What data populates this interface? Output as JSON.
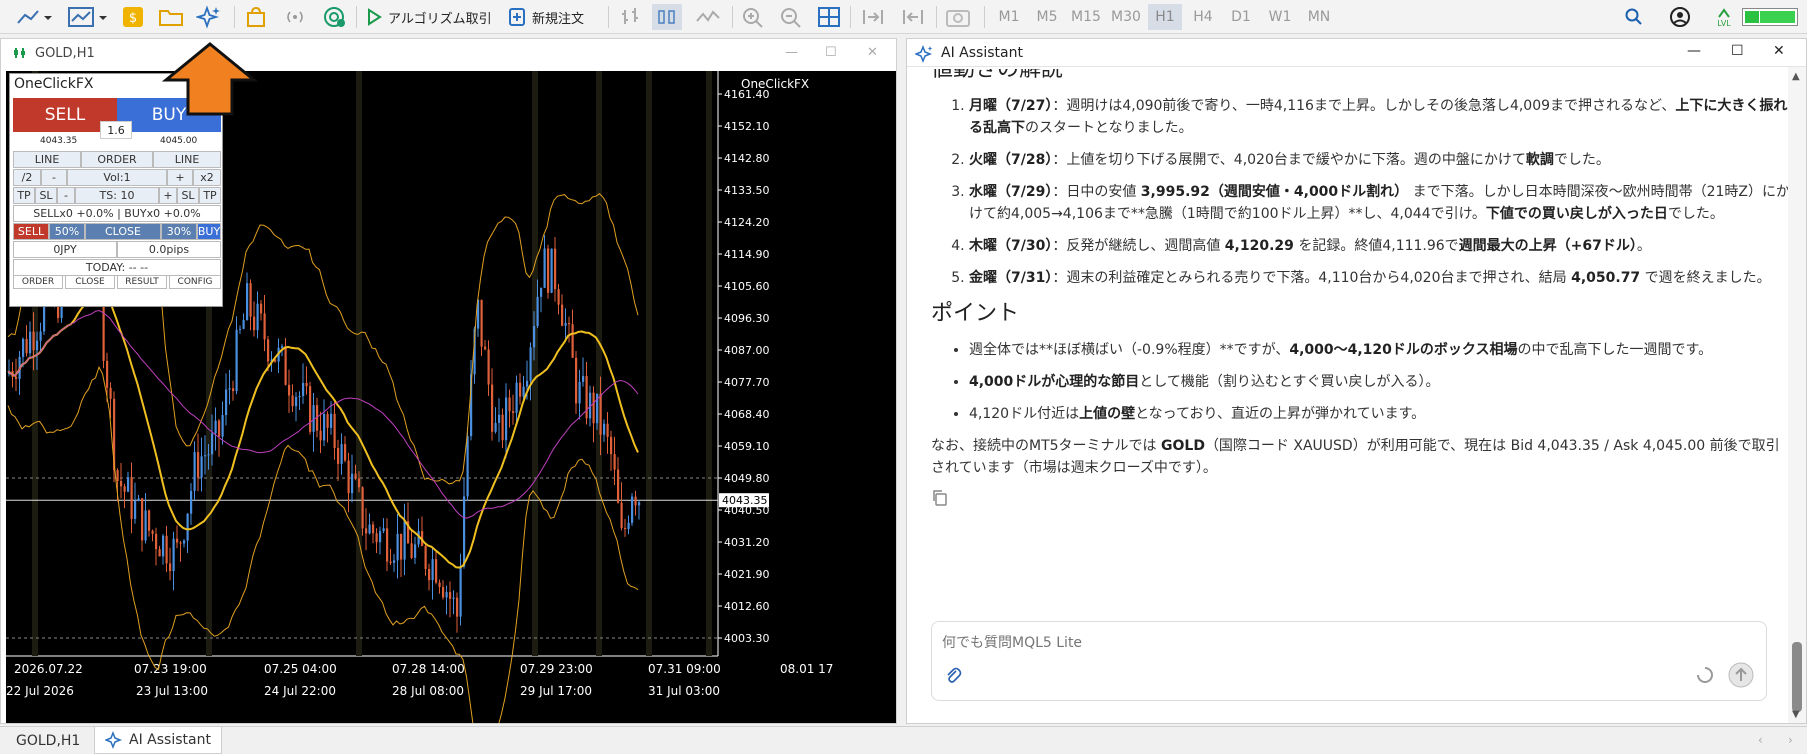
{
  "toolbar": {
    "algo_trading_label": "アルゴリズム取引",
    "new_order_label": "新規注文",
    "timeframes": [
      "M1",
      "M5",
      "M15",
      "M30",
      "H1",
      "H4",
      "D1",
      "W1",
      "MN"
    ],
    "active_timeframe": "H1",
    "status_label": "LVL"
  },
  "chart_window": {
    "title": "GOLD,H1",
    "symbol_label": "OneClickFX",
    "current_price": "4043.35",
    "price_ticks": [
      "4161.40",
      "4152.10",
      "4142.80",
      "4133.50",
      "4124.20",
      "4114.90",
      "4105.60",
      "4096.30",
      "4087.00",
      "4077.70",
      "4068.40",
      "4059.10",
      "4049.80",
      "4040.50",
      "4031.20",
      "4021.90",
      "4012.60",
      "4003.30"
    ],
    "time_ticks_top": [
      "2026.07.22",
      "07.23 19:00",
      "07.25 04:00",
      "07.28 14:00",
      "07.29 23:00",
      "07.31 09:00",
      "08.01 17"
    ],
    "time_ticks_bottom": [
      "22 Jul 2026",
      "23 Jul 13:00",
      "24 Jul 22:00",
      "28 Jul 08:00",
      "29 Jul 17:00",
      "31 Jul 03:00"
    ]
  },
  "oneclick": {
    "title": "OneClickFX",
    "sell_label": "SELL",
    "buy_label": "BUY",
    "spread": "1.6",
    "bid": "4043.35",
    "ask": "4045.00",
    "row1": [
      "LINE",
      "ORDER",
      "LINE"
    ],
    "row2": [
      "/2",
      "-",
      "Vol:1",
      "+",
      "x2"
    ],
    "row3": [
      "TP",
      "SL",
      "-",
      "TS: 10",
      "+",
      "SL",
      "TP"
    ],
    "row4": "SELLx0 +0.0% | BUYx0 +0.0%",
    "row5": [
      "SELL",
      "50%",
      "CLOSE",
      "30%",
      "BUY"
    ],
    "row6": [
      "0JPY",
      "0.0pips"
    ],
    "today": "TODAY: -- --",
    "footer": [
      "ORDER",
      "CLOSE",
      "RESULT",
      "CONFIG"
    ]
  },
  "ai_window": {
    "title": "AI Assistant",
    "partial_heading": "値動きの解説",
    "days": [
      {
        "lead": "月曜（7/27）",
        "text1": "：週明けは4,090前後で寄り、一時4,116まで上昇。しかしその後急落し4,009まで押されるなど、",
        "bold": "上下に大きく振れる乱高下",
        "text2": "のスタートとなりました。"
      },
      {
        "lead": "火曜（7/28）",
        "text1": "：上値を切り下げる展開で、4,020台まで緩やかに下落。週の中盤にかけて",
        "bold": "軟調",
        "text2": "でした。"
      },
      {
        "lead": "水曜（7/29）",
        "text1": "：日中の安値 ",
        "bold": "3,995.92（週間安値・4,000ドル割れ）",
        "text2": " まで下落。しかし日本時間深夜〜欧州時間帯（21時Z）にかけて約4,005→4,106まで**急騰（1時間で約100ドル上昇）**し、4,044で引け。",
        "bold2": "下値での買い戻しが入った日",
        "text3": "でした。"
      },
      {
        "lead": "木曜（7/30）",
        "text1": "：反発が継続し、週間高値 ",
        "bold": "4,120.29",
        "text2": " を記録。終値4,111.96で",
        "bold2": "週間最大の上昇（+67ドル）",
        "text3": "。"
      },
      {
        "lead": "金曜（7/31）",
        "text1": "：週末の利益確定とみられる売りで下落。4,110台から4,020台まで押され、結局 ",
        "bold": "4,050.77",
        "text2": " で週を終えました。"
      }
    ],
    "points_heading": "ポイント",
    "points": [
      {
        "text1": "週全体では**ほぼ横ばい（-0.9%程度）**ですが、",
        "bold": "4,000〜4,120ドルのボックス相場",
        "text2": "の中で乱高下した一週間です。"
      },
      {
        "text1": "",
        "bold": "4,000ドルが心理的な節目",
        "text2": "として機能（割り込むとすぐ買い戻しが入る）。"
      },
      {
        "text1": "4,120ドル付近は",
        "bold": "上値の壁",
        "text2": "となっており、直近の上昇が弾かれています。"
      }
    ],
    "footer_text1": "なお、接続中のMT5ターミナルでは ",
    "footer_bold": "GOLD",
    "footer_text2": "（国際コード XAUUSD）が利用可能で、現在は Bid 4,043.35 / Ask 4,045.00 前後で取引されています（市場は週末クローズ中です）。",
    "input_placeholder": "何でも質問MQL5 Lite"
  },
  "bottom_tabs": [
    "GOLD,H1",
    "AI Assistant"
  ],
  "colors": {
    "sell": "#c0392b",
    "buy": "#3b6fd8",
    "accent_arrow": "#f08020",
    "bull": "#4a8fe0",
    "bear": "#e0603a"
  }
}
